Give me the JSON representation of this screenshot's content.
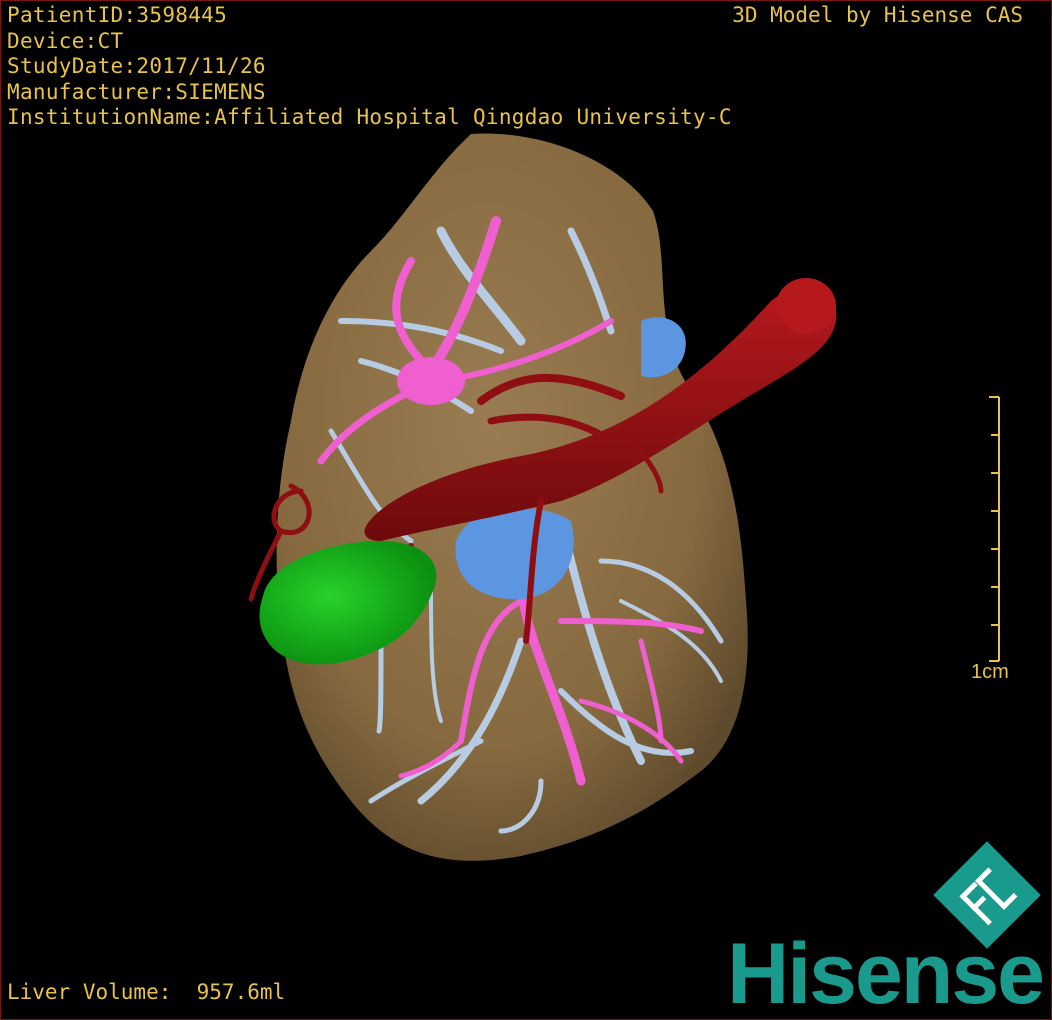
{
  "header": {
    "patient_id": "PatientID:3598445",
    "device": "Device:CT",
    "study_date": "StudyDate:2017/11/26",
    "manufacturer": "Manufacturer:SIEMENS",
    "institution": "InstitutionName:Affiliated Hospital Qingdao University-C",
    "model_credit": "3D Model by Hisense CAS"
  },
  "footer": {
    "liver_volume": "Liver Volume:  957.6ml"
  },
  "scale": {
    "label": "1cm"
  },
  "brand": {
    "name": "Hisense",
    "logo_icon": "hisense-cas-logo-icon",
    "color": "#1a9a8c"
  },
  "colors": {
    "liver": "#8a6e48",
    "hepatic_vein": "#b7cbe3",
    "portal_vein": "#f05fd0",
    "vena_cava": "#5d96e0",
    "artery_aorta": "#9a0f12",
    "gallbladder": "#12b318",
    "overlay_text": "#e8c24a"
  }
}
